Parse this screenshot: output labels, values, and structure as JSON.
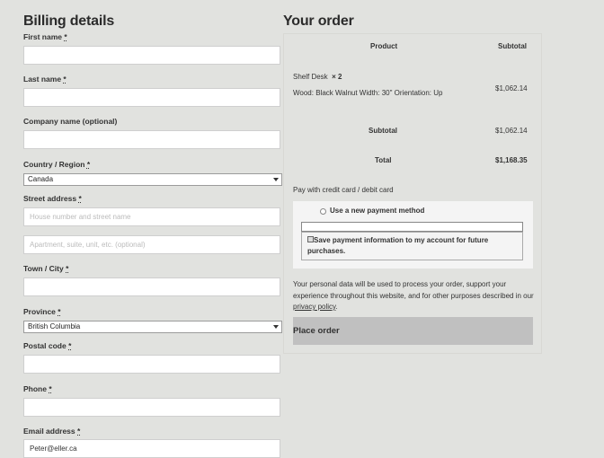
{
  "billing": {
    "title": "Billing details",
    "required_mark": "*",
    "first_name": {
      "label": "First name",
      "value": ""
    },
    "last_name": {
      "label": "Last name",
      "value": ""
    },
    "company": {
      "label": "Company name (optional)",
      "value": ""
    },
    "country": {
      "label": "Country / Region",
      "value": "Canada"
    },
    "street": {
      "label": "Street address",
      "line1_placeholder": "House number and street name",
      "line2_placeholder": "Apartment, suite, unit, etc. (optional)"
    },
    "city": {
      "label": "Town / City",
      "value": ""
    },
    "province": {
      "label": "Province",
      "value": "British Columbia"
    },
    "postal": {
      "label": "Postal code",
      "value": ""
    },
    "phone": {
      "label": "Phone",
      "value": ""
    },
    "email": {
      "label": "Email address",
      "value": "Peter@eller.ca"
    }
  },
  "order": {
    "title": "Your order",
    "col_product": "Product",
    "col_subtotal": "Subtotal",
    "item_name": "Shelf Desk",
    "item_qty": "× 2",
    "item_options": "Wood: Black Walnut Width: 30\" Orientation: Up",
    "item_price": "$1,062.14",
    "subtotal_label": "Subtotal",
    "subtotal_value": "$1,062.14",
    "total_label": "Total",
    "total_value": "$1,168.35",
    "pay_label": "Pay with credit card / debit card",
    "new_method_label": "Use a new payment method",
    "save_payment_label": "Save payment information to my account for future purchases.",
    "privacy_text": "Your personal data will be used to process your order, support your experience throughout this website, and for other purposes described in our",
    "privacy_link": "privacy policy",
    "privacy_end": ".",
    "place_order": "Place order"
  }
}
